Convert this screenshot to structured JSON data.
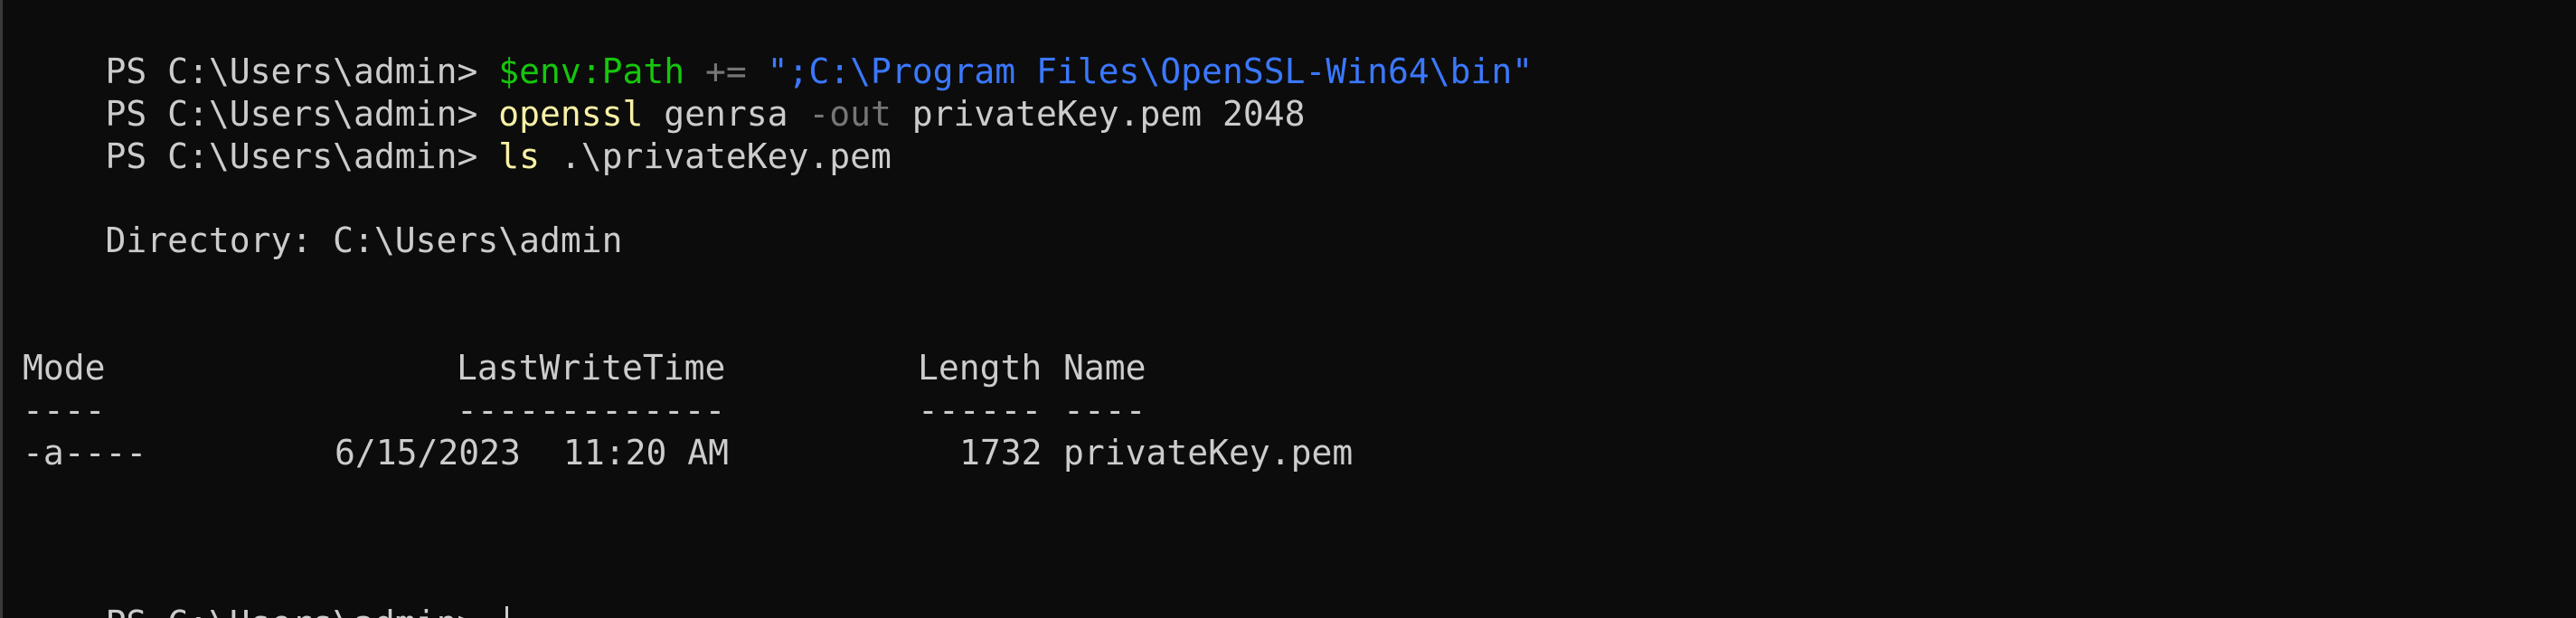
{
  "prompt": "PS C:\\Users\\admin> ",
  "lines": {
    "cmd1": {
      "var": "$env:Path",
      "op": " += ",
      "str": "\";C:\\Program Files\\OpenSSL-Win64\\bin\""
    },
    "cmd2": {
      "cmd": "openssl",
      "arg1": " genrsa ",
      "param": "-out",
      "arg2": " privateKey.pem 2048"
    },
    "cmd3": {
      "cmd": "ls",
      "arg1": " .\\privateKey.pem"
    }
  },
  "directory_line": "    Directory: C:\\Users\\admin",
  "table": {
    "headers": {
      "mode": "Mode",
      "lastwritetime": "LastWriteTime",
      "length": "Length",
      "name": "Name"
    },
    "underlines": {
      "mode": "----",
      "lastwritetime": "-------------",
      "length": "------",
      "name": "----"
    },
    "rows": [
      {
        "mode": "-a----",
        "date": "6/15/2023",
        "time": "11:20 AM",
        "length": "1732",
        "name": "privateKey.pem"
      }
    ]
  },
  "colors": {
    "background": "#0c0c0c",
    "text": "#cccccc",
    "variable": "#16c60c",
    "string": "#3b78ff",
    "command": "#f9f1a5",
    "operator": "#767676"
  }
}
